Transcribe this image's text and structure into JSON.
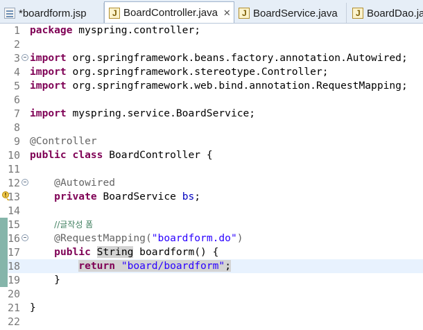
{
  "tabs": [
    {
      "label": "*boardform.jsp",
      "icon": "jsp-file-icon",
      "active": false
    },
    {
      "label": "BoardController.java",
      "icon": "java-file-icon",
      "active": true
    },
    {
      "label": "BoardService.java",
      "icon": "java-file-icon",
      "active": false
    },
    {
      "label": "BoardDao.jav",
      "icon": "java-file-icon",
      "active": false
    }
  ],
  "close_glyph": "✕",
  "lines": [
    {
      "n": "1"
    },
    {
      "n": "2"
    },
    {
      "n": "3"
    },
    {
      "n": "4"
    },
    {
      "n": "5"
    },
    {
      "n": "6"
    },
    {
      "n": "7"
    },
    {
      "n": "8"
    },
    {
      "n": "9"
    },
    {
      "n": "10"
    },
    {
      "n": "11"
    },
    {
      "n": "12"
    },
    {
      "n": "13"
    },
    {
      "n": "14"
    },
    {
      "n": "15"
    },
    {
      "n": "16"
    },
    {
      "n": "17"
    },
    {
      "n": "18"
    },
    {
      "n": "19"
    },
    {
      "n": "20"
    },
    {
      "n": "21"
    },
    {
      "n": "22"
    }
  ],
  "code": {
    "l1_kw": "package",
    "l1_rest": " myspring.controller;",
    "l3_kw": "import",
    "l3_rest": " org.springframework.beans.factory.annotation.Autowired;",
    "l4_kw": "import",
    "l4_rest": " org.springframework.stereotype.Controller;",
    "l5_kw": "import",
    "l5_rest": " org.springframework.web.bind.annotation.RequestMapping;",
    "l7_kw": "import",
    "l7_rest": " myspring.service.BoardService;",
    "l9_ann": "@Controller",
    "l10_kw1": "public",
    "l10_kw2": "class",
    "l10_rest": " BoardController {",
    "l12_ann": "@Autowired",
    "l13_kw": "private",
    "l13_type": " BoardService ",
    "l13_field": "bs",
    "l13_end": ";",
    "l15_comment": "//글작성 폼",
    "l16_ann": "@RequestMapping(",
    "l16_str": "\"boardform.do\"",
    "l16_end": ")",
    "l17_kw": "public",
    "l17_type": "String",
    "l17_rest": " boardform() {",
    "l18_kw": "return",
    "l18_str": "\"board/boardform\"",
    "l18_end": ";",
    "l19_brace": "}",
    "l21_brace": "}"
  },
  "colors": {
    "keyword": "#7f0055",
    "annotation": "#646464",
    "string": "#2a00ff",
    "comment": "#3f7f5f",
    "field": "#0000c0",
    "current_line": "#e8f2fe",
    "change_bar": "#85b5aa"
  }
}
